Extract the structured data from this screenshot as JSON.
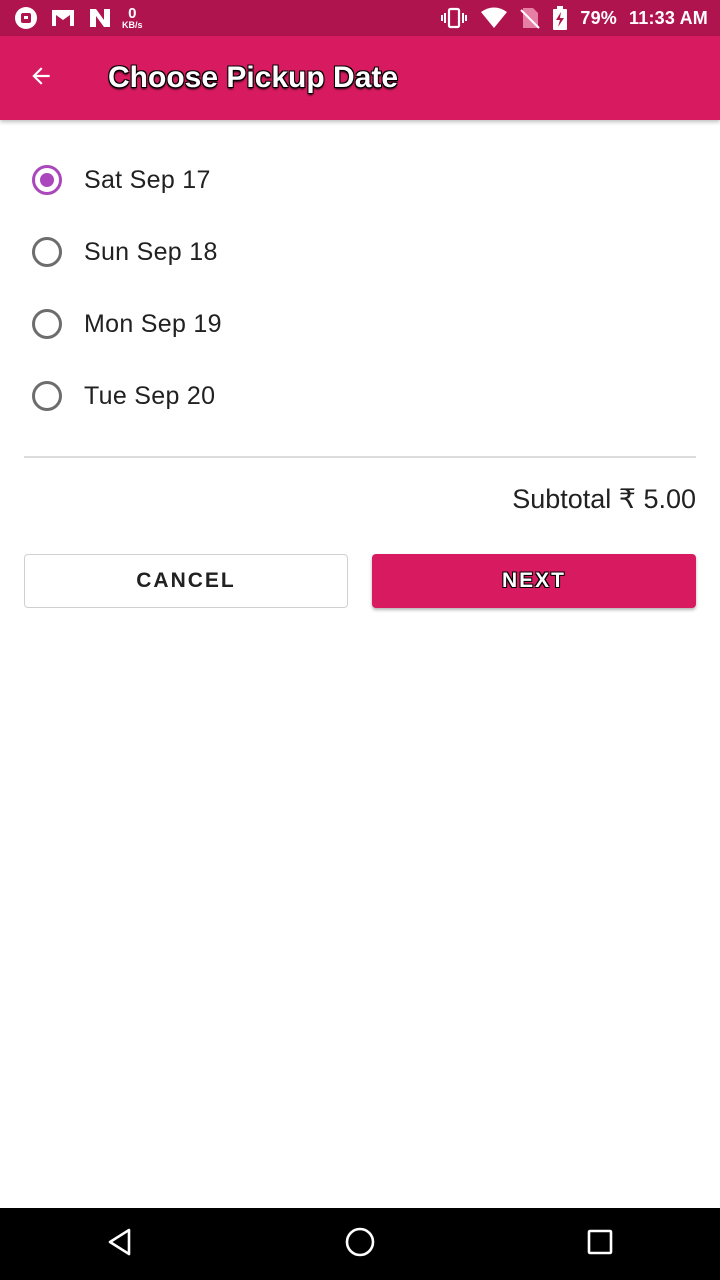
{
  "status_bar": {
    "net_speed_value": "0",
    "net_speed_unit": "KB/s",
    "battery_percent": "79%",
    "time": "11:33 AM",
    "icons": [
      "notification-app-icon",
      "gmail-icon",
      "n-app-icon",
      "vibrate-icon",
      "wifi-icon",
      "no-sim-icon",
      "battery-charging-icon"
    ]
  },
  "app_bar": {
    "title": "Choose Pickup Date",
    "back_icon": "arrow-back-icon"
  },
  "dates": {
    "options": [
      {
        "label": "Sat Sep 17",
        "selected": true
      },
      {
        "label": "Sun Sep 18",
        "selected": false
      },
      {
        "label": "Mon Sep 19",
        "selected": false
      },
      {
        "label": "Tue Sep 20",
        "selected": false
      }
    ]
  },
  "summary": {
    "subtotal_text": "Subtotal ₹ 5.00"
  },
  "actions": {
    "cancel_label": "CANCEL",
    "next_label": "NEXT"
  },
  "nav_bar": {
    "icons": [
      "back-triangle-icon",
      "home-circle-icon",
      "recents-square-icon"
    ]
  },
  "colors": {
    "status_bar": "#b0144f",
    "primary": "#d81b60",
    "radio_accent": "#ab47bc"
  }
}
